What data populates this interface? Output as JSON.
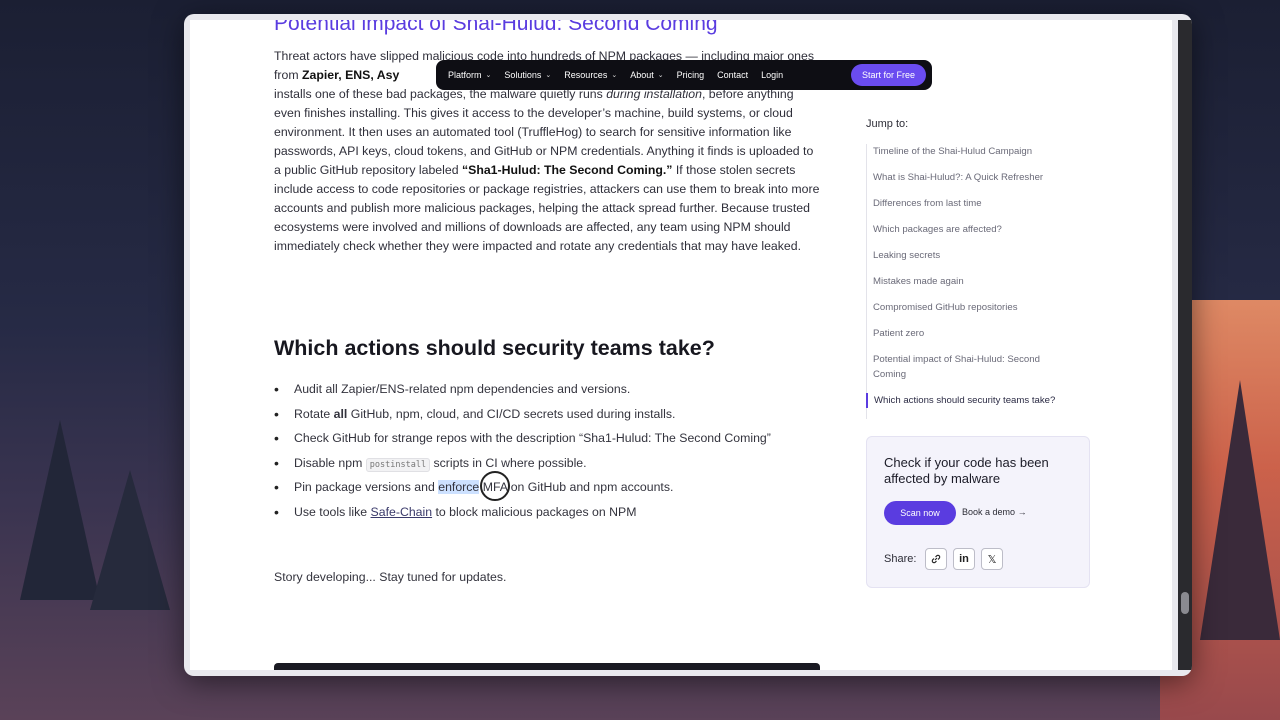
{
  "navbar": {
    "items": [
      {
        "label": "Platform",
        "has_dropdown": true
      },
      {
        "label": "Solutions",
        "has_dropdown": true
      },
      {
        "label": "Resources",
        "has_dropdown": true
      },
      {
        "label": "About",
        "has_dropdown": true
      },
      {
        "label": "Pricing",
        "has_dropdown": false
      },
      {
        "label": "Contact",
        "has_dropdown": false
      },
      {
        "label": "Login",
        "has_dropdown": false
      }
    ],
    "cta_label": "Start for Free"
  },
  "article": {
    "prev_heading": "Potential impact of Shai-Hulud: Second Coming",
    "para": {
      "p1": "Threat actors have slipped malicious code into hundreds of NPM packages — including major ones from ",
      "p1_bold": "Zapier, ENS, Asy",
      "p2": "installs one of these bad packages, the malware quietly runs ",
      "p2_italic": "during installation",
      "p3": ", before anything even finishes installing. This gives it access to the developer’s machine, build systems, or cloud environment. It then uses an automated tool (TruffleHog) to search for sensitive information like passwords, API keys, cloud tokens, and GitHub or NPM credentials. Anything it finds is uploaded to a public GitHub repository labeled ",
      "p3_bold": "“Sha1-Hulud: The Second Coming.”",
      "p4": " If those stolen secrets include access to code repositories or package registries, attackers can use them to break into more accounts and publish more malicious packages, helping the attack spread further. Because trusted ecosystems were involved and millions of downloads are affected, any team using NPM should immediately check whether they were impacted and rotate any credentials that may have leaked."
    },
    "section_heading": "Which actions should security teams take?",
    "bullets": {
      "b1": "Audit all Zapier/ENS-related npm dependencies and versions.",
      "b2_pre": "Rotate ",
      "b2_bold": "all",
      "b2_post": " GitHub, npm, cloud, and CI/CD secrets used during installs.",
      "b3": "Check GitHub for strange repos with the description  “Sha1-Hulud: The Second Coming”",
      "b4_pre": "Disable npm ",
      "b4_code": "postinstall",
      "b4_post": " scripts in CI where possible.",
      "b5_pre": "Pin package versions and ",
      "b5_highlight": "enforce",
      "b5_post": " MFA on GitHub and npm accounts.",
      "b6_pre": "Use tools like ",
      "b6_link": "Safe-Chain",
      "b6_post": " to block malicious packages on NPM"
    },
    "story_text": "Story developing... Stay tuned for updates."
  },
  "sidebar": {
    "jump_label": "Jump to:",
    "toc": [
      {
        "label": "Timeline of the Shai-Hulud Campaign",
        "active": false
      },
      {
        "label": "What is Shai-Hulud?: A Quick Refresher",
        "active": false
      },
      {
        "label": "Differences from last time",
        "active": false
      },
      {
        "label": "Which packages are affected?",
        "active": false
      },
      {
        "label": "Leaking secrets",
        "active": false
      },
      {
        "label": "Mistakes made again",
        "active": false
      },
      {
        "label": "Compromised GitHub repositories",
        "active": false
      },
      {
        "label": "Patient zero",
        "active": false
      },
      {
        "label": "Potential impact of Shai-Hulud: Second Coming",
        "active": false
      },
      {
        "label": "Which actions should security teams take?",
        "active": true
      }
    ],
    "card": {
      "title": "Check if your code has been affected by malware",
      "scan_label": "Scan now",
      "demo_label": "Book a demo",
      "demo_arrow": "→",
      "share_label": "Share:",
      "share_icons": [
        "link-icon",
        "linkedin-icon",
        "x-icon"
      ],
      "linkedin_glyph": "in",
      "x_glyph": "𝕏"
    }
  },
  "colors": {
    "accent": "#5a3ce0",
    "nav_bg": "#0e0e14",
    "card_bg": "#f4f3fb"
  }
}
